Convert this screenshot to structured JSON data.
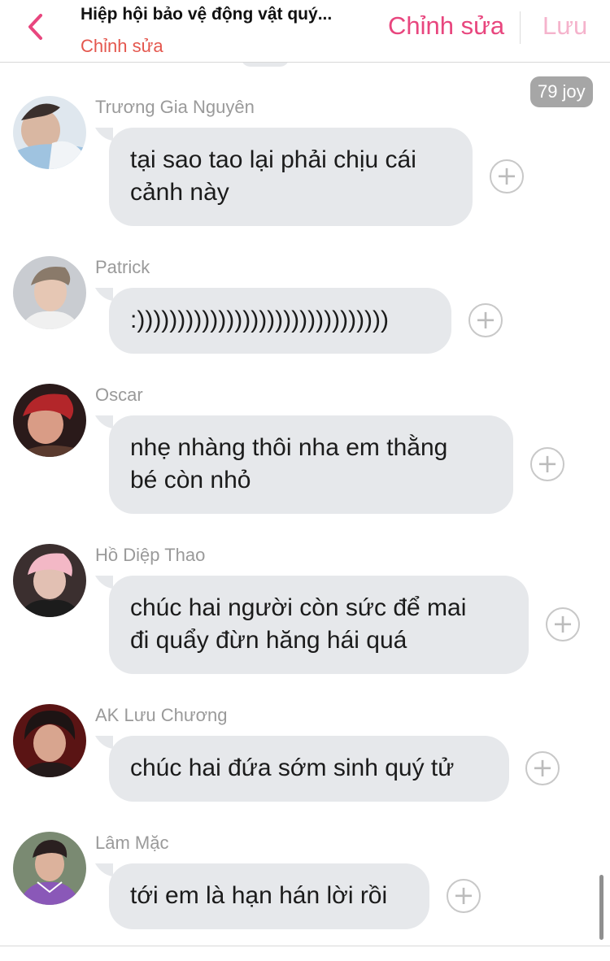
{
  "header": {
    "title": "Hiệp hội bảo vệ động vật quý...",
    "subtitle": "Chỉnh sửa",
    "edit_label": "Chỉnh sửa",
    "save_label": "Lưu"
  },
  "badge": {
    "count": "79",
    "label": "joy"
  },
  "messages": [
    {
      "sender": "Trương Gia Nguyên",
      "text": "tại sao tao lại phải chịu cái\ncảnh này",
      "avatar": "avatar-photo"
    },
    {
      "sender": "Patrick",
      "text": ":)))))))))))))))))))))))))))))))",
      "avatar": "avatar-photo"
    },
    {
      "sender": "Oscar",
      "text": "nhẹ nhàng thôi nha em thằng\nbé còn nhỏ",
      "avatar": "avatar-photo"
    },
    {
      "sender": "Hồ Diệp Thao",
      "text": "chúc hai người còn sức để mai\nđi quẩy đừn hăng hái quá",
      "avatar": "avatar-photo"
    },
    {
      "sender": "AK Lưu Chương",
      "text": "chúc hai đứa sớm sinh quý tử",
      "avatar": "avatar-photo"
    },
    {
      "sender": "Lâm Mặc",
      "text": "tới em là hạn hán lời rồi",
      "avatar": "avatar-photo"
    }
  ],
  "icons": {
    "back": "chevron-left-icon",
    "react": "plus-circle-icon"
  },
  "colors": {
    "accent": "#e8467e",
    "accent_light": "#f5b3cc",
    "subtitle": "#e4574e",
    "bubble": "#e6e8eb",
    "badge": "#a6a6a6",
    "sender": "#9a9a9a"
  }
}
